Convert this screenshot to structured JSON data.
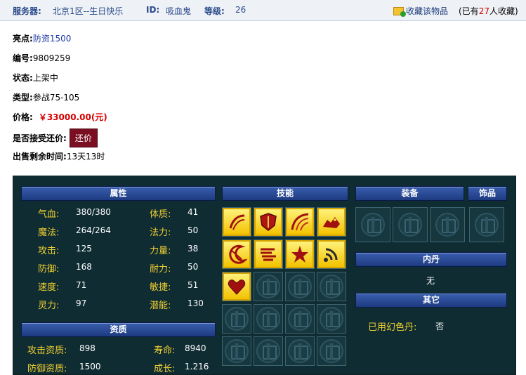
{
  "header": {
    "server_label": "服务器:",
    "server_value": "北京1区--生日快乐",
    "id_label": "ID:",
    "id_value": "吸血鬼",
    "level_label": "等级:",
    "level_value": "26",
    "favorite_label": "收藏该物品",
    "fav_count_prefix": "(已有",
    "fav_count": "27",
    "fav_count_suffix": "人收藏)"
  },
  "info": {
    "highlight_label": "亮点:",
    "highlight_value": "防资1500",
    "number_label": "编号:",
    "number_value": "9809259",
    "status_label": "状态:",
    "status_value": "上架中",
    "type_label": "类型:",
    "type_value": "参战75-105",
    "price_label": "价格:",
    "price_value": "￥33000.00(元)",
    "counter_label": "是否接受还价:",
    "counter_button": "还价",
    "remaining_label": "出售剩余时间:",
    "remaining_value": "13天13时"
  },
  "panel": {
    "attributes_title": "属性",
    "skills_title": "技能",
    "equip_title": "装备",
    "accessory_title": "饰品",
    "neidan_title": "内丹",
    "neidan_value": "无",
    "other_title": "其它",
    "other_label": "已用幻色丹:",
    "other_value": "否",
    "aptitude_title": "资质",
    "attributes": [
      {
        "label": "气血:",
        "value": "380/380"
      },
      {
        "label": "魔法:",
        "value": "264/264"
      },
      {
        "label": "攻击:",
        "value": "125"
      },
      {
        "label": "防御:",
        "value": "168"
      },
      {
        "label": "速度:",
        "value": "71"
      },
      {
        "label": "灵力:",
        "value": "97"
      }
    ],
    "attributes2": [
      {
        "label": "体质:",
        "value": "41"
      },
      {
        "label": "法力:",
        "value": "50"
      },
      {
        "label": "力量:",
        "value": "38"
      },
      {
        "label": "耐力:",
        "value": "50"
      },
      {
        "label": "敏捷:",
        "value": "51"
      },
      {
        "label": "潜能:",
        "value": "130"
      }
    ],
    "aptitudes": [
      {
        "label": "攻击资质:",
        "value": "898"
      },
      {
        "label": "防御资质:",
        "value": "1500"
      }
    ],
    "aptitudes2": [
      {
        "label": "寿命:",
        "value": "8940"
      },
      {
        "label": "成长:",
        "value": "1.216"
      }
    ],
    "skill_icons": [
      "claw-skill-icon",
      "shield-skill-icon",
      "arc-skill-icon",
      "beast-skill-icon",
      "moon-skill-icon",
      "wind-skill-icon",
      "shatter-skill-icon",
      "wave-skill-icon",
      "heart-skill-icon"
    ]
  }
}
